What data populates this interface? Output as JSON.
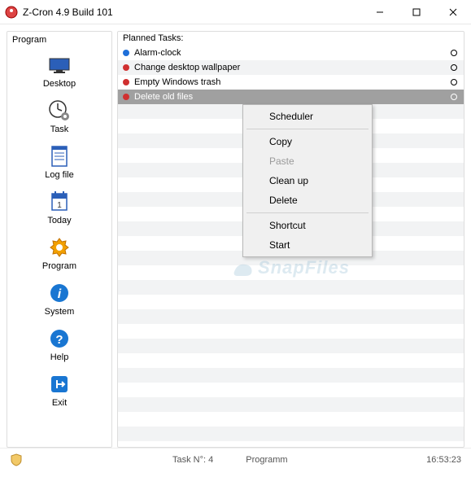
{
  "window": {
    "title": "Z-Cron 4.9 Build 101"
  },
  "sidebar": {
    "header": "Program",
    "items": [
      {
        "label": "Desktop",
        "icon": "desktop-icon"
      },
      {
        "label": "Task",
        "icon": "task-icon"
      },
      {
        "label": "Log file",
        "icon": "logfile-icon"
      },
      {
        "label": "Today",
        "icon": "today-icon"
      },
      {
        "label": "Program",
        "icon": "program-icon"
      },
      {
        "label": "System",
        "icon": "system-icon"
      },
      {
        "label": "Help",
        "icon": "help-icon"
      },
      {
        "label": "Exit",
        "icon": "exit-icon"
      }
    ]
  },
  "main": {
    "header": "Planned Tasks:",
    "tasks": [
      {
        "name": "Alarm-clock",
        "dot": "blue"
      },
      {
        "name": "Change desktop wallpaper",
        "dot": "red"
      },
      {
        "name": "Empty Windows trash",
        "dot": "red"
      },
      {
        "name": "Delete old files",
        "dot": "red",
        "selected": true
      }
    ]
  },
  "contextmenu": {
    "items": [
      {
        "label": "Scheduler"
      },
      {
        "sep": true
      },
      {
        "label": "Copy"
      },
      {
        "label": "Paste",
        "disabled": true
      },
      {
        "label": "Clean up"
      },
      {
        "label": "Delete"
      },
      {
        "sep": true
      },
      {
        "label": "Shortcut"
      },
      {
        "label": "Start"
      }
    ]
  },
  "statusbar": {
    "task_count": "Task N°: 4",
    "program": "Programm",
    "time": "16:53:23"
  },
  "watermark": "SnapFiles"
}
